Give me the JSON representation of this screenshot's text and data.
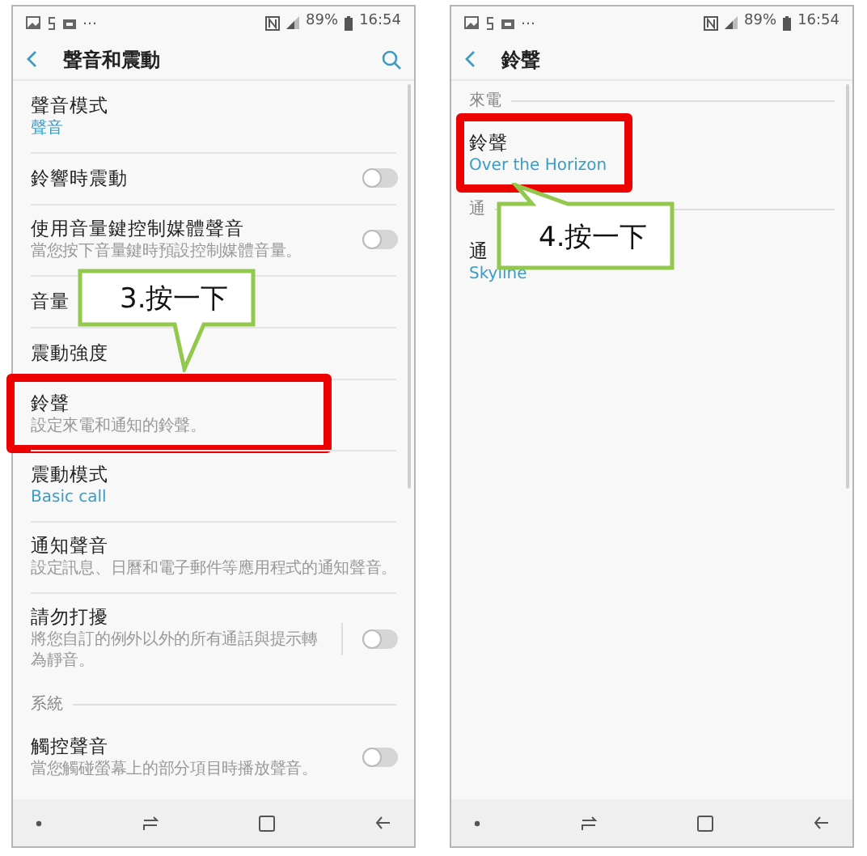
{
  "screens": [
    {
      "status_bar": {
        "overflow": "…",
        "battery": "89%",
        "time": "16:54"
      },
      "title": "聲音和震動",
      "search": true,
      "items": [
        {
          "kind": "item",
          "title": "聲音模式",
          "value": "聲音",
          "highlighted": false
        },
        {
          "kind": "toggle",
          "title": "鈴響時震動",
          "on": false,
          "split": false,
          "highlighted": false
        },
        {
          "kind": "toggle",
          "title": "使用音量鍵控制媒體聲音",
          "summary": "當您按下音量鍵時預設控制媒體音量。",
          "on": false,
          "split": false,
          "highlighted": false
        },
        {
          "kind": "item",
          "title": "音量",
          "highlighted": false
        },
        {
          "kind": "item",
          "title": "震動強度",
          "highlighted": false
        },
        {
          "kind": "item",
          "title": "鈴聲",
          "summary": "設定來電和通知的鈴聲。",
          "highlighted": true
        },
        {
          "kind": "item",
          "title": "震動模式",
          "value": "Basic call",
          "highlighted": false
        },
        {
          "kind": "item",
          "title": "通知聲音",
          "summary": "設定訊息、日曆和電子郵件等應用程式的通知聲音。",
          "highlighted": false
        },
        {
          "kind": "toggle",
          "title": "請勿打擾",
          "summary": "將您自訂的例外以外的所有通話與提示轉為靜音。",
          "on": false,
          "split": true,
          "highlighted": false
        },
        {
          "kind": "header",
          "title": "系統"
        },
        {
          "kind": "toggle",
          "title": "觸控聲音",
          "summary": "當您觸碰螢幕上的部分項目時播放聲音。",
          "on": false,
          "split": false,
          "highlighted": false
        }
      ],
      "callout": {
        "text": "3.按一下"
      }
    },
    {
      "status_bar": {
        "overflow": "…",
        "battery": "89%",
        "time": "16:54"
      },
      "title": "鈴聲",
      "search": false,
      "items": [
        {
          "kind": "header",
          "title": "來電"
        },
        {
          "kind": "item",
          "title": "鈴聲",
          "value": "Over the Horizon",
          "highlighted": true
        },
        {
          "kind": "header",
          "title": "通"
        },
        {
          "kind": "item",
          "title": "通",
          "value": "Skyline",
          "highlighted": false
        }
      ],
      "callout": {
        "text": "4.按一下"
      }
    }
  ]
}
